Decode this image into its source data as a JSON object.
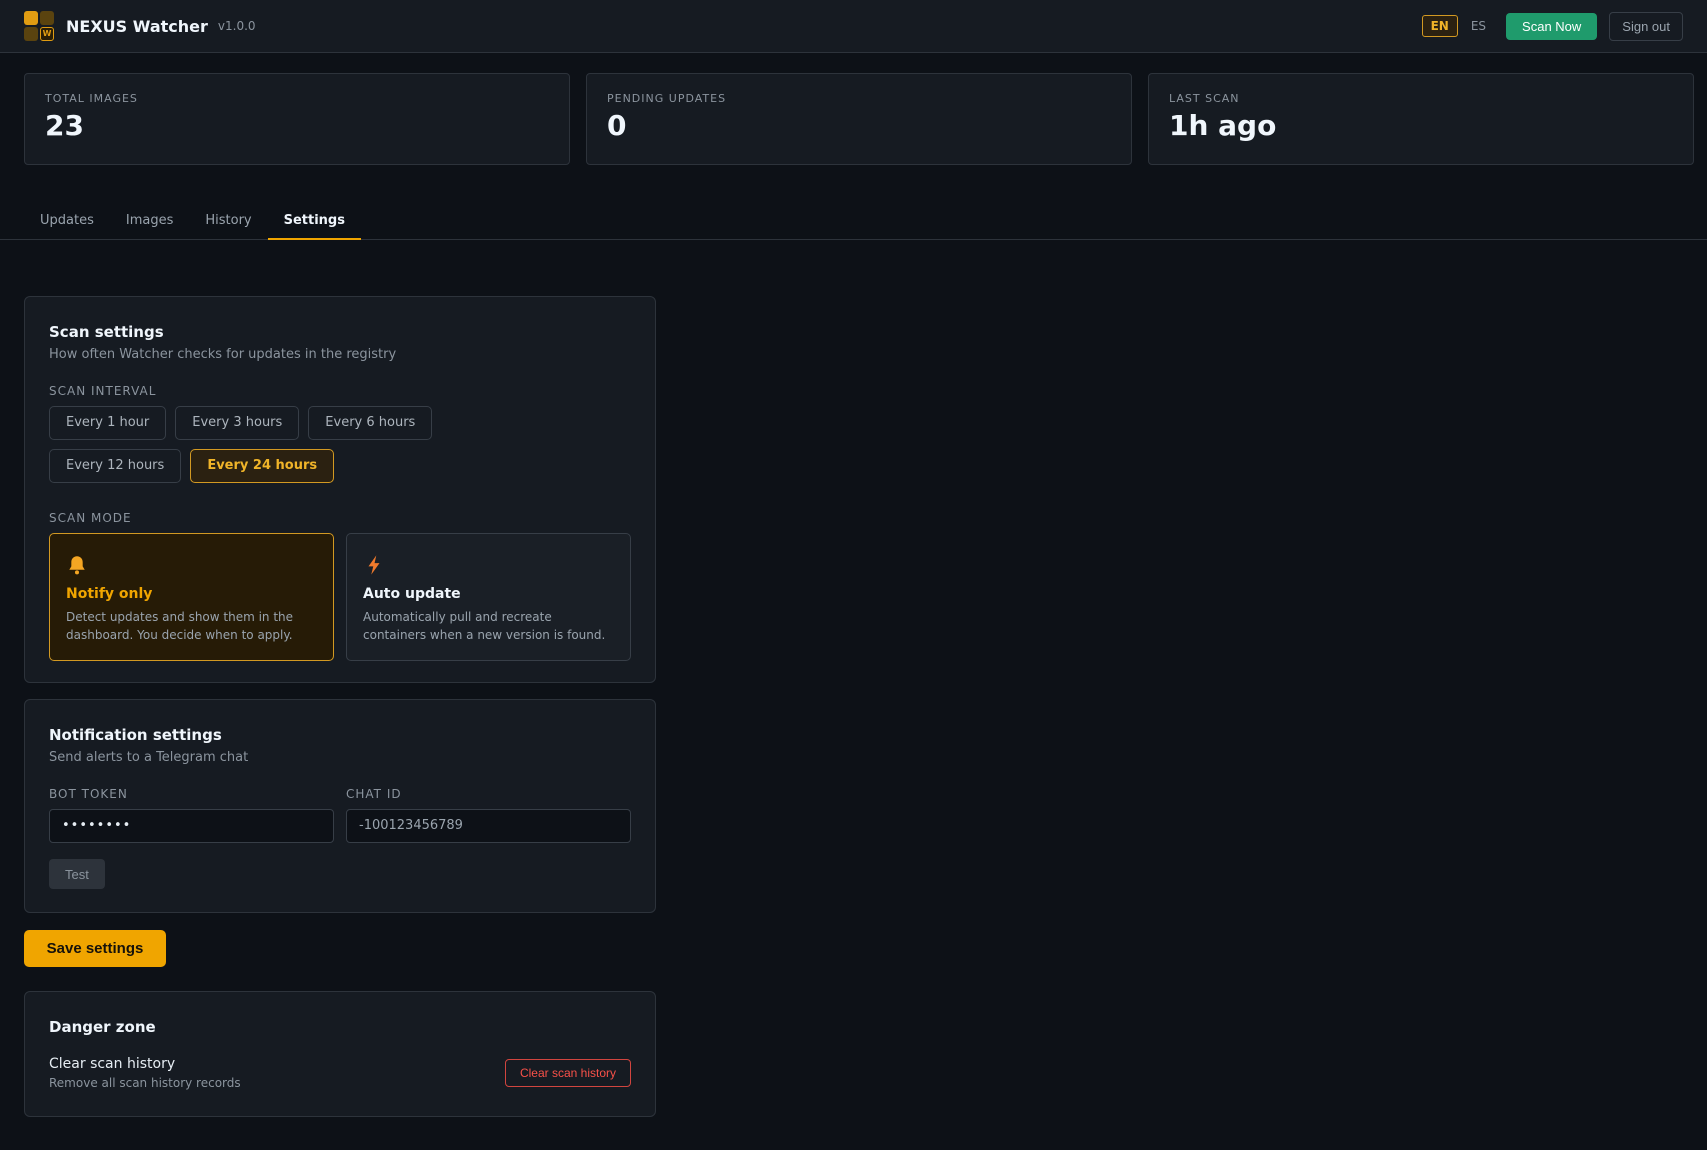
{
  "header": {
    "brand": "NEXUS Watcher",
    "version": "v1.0.0",
    "lang_en": "EN",
    "lang_es": "ES",
    "scan_now": "Scan Now",
    "sign_out": "Sign out"
  },
  "stats": [
    {
      "label": "TOTAL IMAGES",
      "value": "23"
    },
    {
      "label": "PENDING UPDATES",
      "value": "0"
    },
    {
      "label": "LAST SCAN",
      "value": "1h ago"
    }
  ],
  "tabs": [
    {
      "label": "Updates",
      "active": false
    },
    {
      "label": "Images",
      "active": false
    },
    {
      "label": "History",
      "active": false
    },
    {
      "label": "Settings",
      "active": true
    }
  ],
  "scan_settings": {
    "title": "Scan settings",
    "subtitle": "How often Watcher checks for updates in the registry",
    "interval_label": "SCAN INTERVAL",
    "intervals": [
      {
        "label": "Every 1 hour",
        "selected": false
      },
      {
        "label": "Every 3 hours",
        "selected": false
      },
      {
        "label": "Every 6 hours",
        "selected": false
      },
      {
        "label": "Every 12 hours",
        "selected": false
      },
      {
        "label": "Every 24 hours",
        "selected": true
      }
    ],
    "mode_label": "SCAN MODE",
    "modes": [
      {
        "icon": "bell-icon",
        "title": "Notify only",
        "description": "Detect updates and show them in the dashboard. You decide when to apply.",
        "selected": true
      },
      {
        "icon": "lightning-icon",
        "title": "Auto update",
        "description": "Automatically pull and recreate containers when a new version is found.",
        "selected": false
      }
    ]
  },
  "notification_settings": {
    "title": "Notification settings",
    "subtitle": "Send alerts to a Telegram chat",
    "bot_token_label": "BOT TOKEN",
    "bot_token_value": "••••••••",
    "chat_id_label": "CHAT ID",
    "chat_id_value": "-100123456789",
    "test_label": "Test"
  },
  "save_label": "Save settings",
  "danger_zone": {
    "title": "Danger zone",
    "item_name": "Clear scan history",
    "item_description": "Remove all scan history records",
    "button_label": "Clear scan history"
  },
  "colors": {
    "background": "#0d1117",
    "surface": "#161b22",
    "accent": "#f0a500",
    "success": "#1f9b6c",
    "danger": "#f85149"
  }
}
